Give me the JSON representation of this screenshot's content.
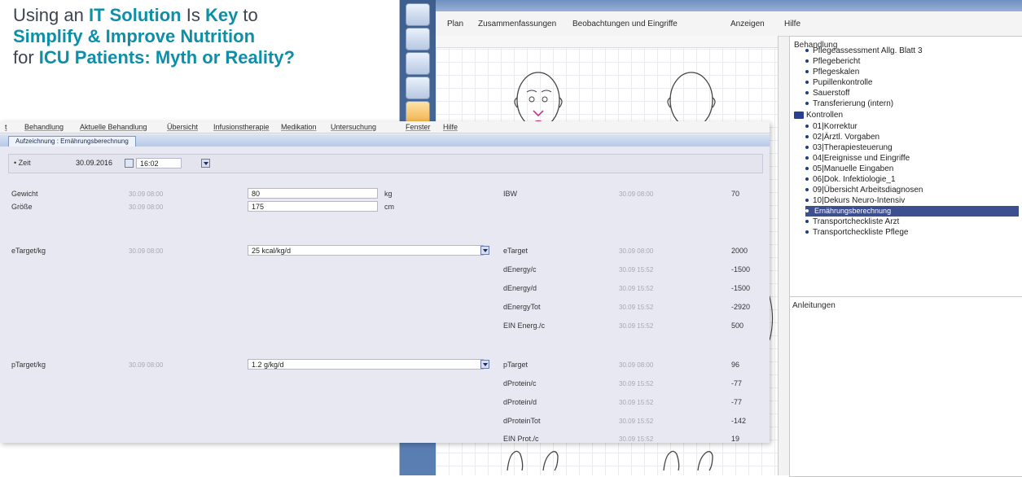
{
  "headline": {
    "line1_prefix": "Using an ",
    "line1_em1": "IT Solution",
    "line1_mid": " Is ",
    "line1_em2": "Key",
    "line1_suffix": " to",
    "line2_em": "Simplify & Improve Nutrition",
    "line3_prefix": "for ",
    "line3_em": "ICU Patients: Myth or Reality?"
  },
  "back_window": {
    "menu": [
      "Plan",
      "Zusammenfassungen",
      "Beobachtungen und Eingriffe",
      "Anzeigen",
      "Hilfe"
    ],
    "treatment_panel_title": "Behandlung",
    "tree_items": [
      "Pflegeassessment Allg. Blatt 3",
      "Pflegebericht",
      "Pflegeskalen",
      "Pupillenkontrolle",
      "Sauerstoff",
      "Transferierung (intern)"
    ],
    "folder_label": "Kontrollen",
    "folder_items": [
      "01|Korrektur",
      "02|Ärztl. Vorgaben",
      "03|Therapiesteuerung",
      "04|Ereignisse und Eingriffe",
      "05|Manuelle Eingaben",
      "06|Dok. Infektiologie_1",
      "09|Übersicht Arbeitsdiagnosen",
      "10|Dekurs Neuro-Intensiv",
      "Ernährungsberechnung",
      "Transportcheckliste Arzt",
      "Transportcheckliste Pflege"
    ],
    "selected_item": "Ernährungsberechnung",
    "instructions_title": "Anleitungen"
  },
  "front_window": {
    "menu": [
      "t",
      "Behandlung",
      "Aktuelle Behandlung",
      "Übersicht",
      "Infusionstherapie",
      "Medikation",
      "Untersuchung",
      "Fenster",
      "Hilfe"
    ],
    "tab_title": "Aufzeichnung : Ernährungsberechnung",
    "time_label": "• Zeit",
    "date_value": "30.09.2016",
    "time_value": "16:02",
    "left_rows": [
      {
        "label": "Gewicht",
        "ts": "30.09 08:00",
        "value": "80",
        "unit": "kg"
      },
      {
        "label": "Größe",
        "ts": "30.09 08:00",
        "value": "175",
        "unit": "cm"
      }
    ],
    "etarget": {
      "label": "eTarget/kg",
      "ts": "30.09 08:00",
      "value": "25 kcal/kg/d"
    },
    "ptarget": {
      "label": "pTarget/kg",
      "ts": "30.09 08:00",
      "value": "1.2 g/kg/d"
    },
    "ibw": {
      "label": "IBW",
      "ts": "30.09 08:00",
      "value": "70"
    },
    "energy_rows": [
      {
        "label": "eTarget",
        "ts": "30.09 08:00",
        "value": "2000"
      },
      {
        "label": "dEnergy/c",
        "ts": "30.09 15:52",
        "value": "-1500"
      },
      {
        "label": "dEnergy/d",
        "ts": "30.09 15:52",
        "value": "-1500"
      },
      {
        "label": "dEnergyTot",
        "ts": "30.09 15:52",
        "value": "-2920"
      },
      {
        "label": "EIN Energ./c",
        "ts": "30.09 15:52",
        "value": "500"
      }
    ],
    "protein_rows": [
      {
        "label": "pTarget",
        "ts": "30.09 08:00",
        "value": "96"
      },
      {
        "label": "dProtein/c",
        "ts": "30.09 15:52",
        "value": "-77"
      },
      {
        "label": "dProtein/d",
        "ts": "30.09 15:52",
        "value": "-77"
      },
      {
        "label": "dProteinTot",
        "ts": "30.09 15:52",
        "value": "-142"
      },
      {
        "label": "EIN Prot./c",
        "ts": "30.09 15:52",
        "value": "19"
      }
    ]
  }
}
